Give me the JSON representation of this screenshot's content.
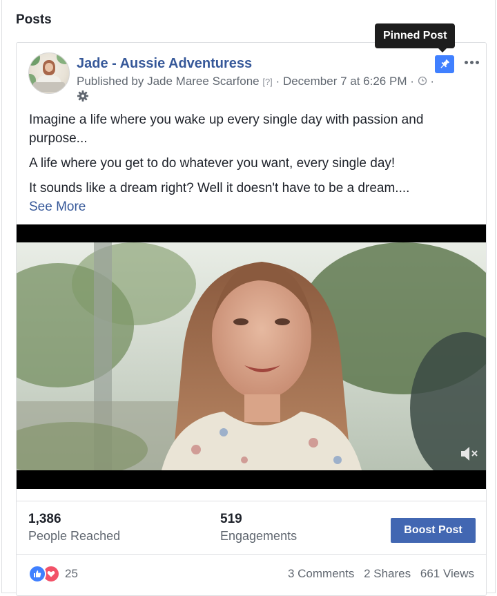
{
  "section": {
    "title": "Posts"
  },
  "post": {
    "page_name": "Jade - Aussie Adventuress",
    "published_by": "Published by Jade Maree Scarfone",
    "help_marker": "[?]",
    "timestamp": "December 7 at 6:26 PM",
    "separator": "·",
    "pin_tooltip": "Pinned Post",
    "paragraphs": [
      "Imagine a life where you wake up every single day with passion and purpose...",
      "A life where you get to do whatever you want, every single day!",
      "It sounds like a dream right? Well it doesn't have to be a dream...."
    ],
    "see_more": "See More"
  },
  "insights": {
    "reach_value": "1,386",
    "reach_label": "People Reached",
    "engagement_value": "519",
    "engagement_label": "Engagements",
    "boost_label": "Boost Post"
  },
  "footer": {
    "reactions_count": "25",
    "comments": "3 Comments",
    "shares": "2 Shares",
    "views": "661 Views"
  },
  "colors": {
    "link": "#365899",
    "pin": "#4080ff",
    "boost": "#4267b2"
  },
  "icons": [
    "gear-icon",
    "pin-icon",
    "more-icon",
    "mute-icon",
    "like-icon",
    "love-icon",
    "clock-icon"
  ]
}
